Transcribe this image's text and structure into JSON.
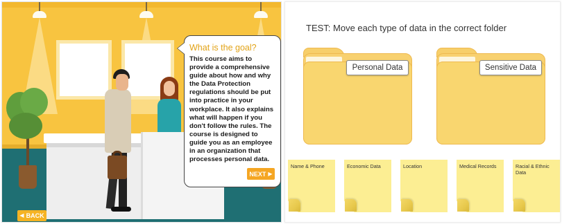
{
  "left_panel": {
    "card": {
      "title": "What is the goal?",
      "body": "This course aims to provide a comprehensive guide about how and why the Data Protection regulations should be put into practice in your workplace. It also explains what will happen if you don't follow the rules. The course is designed to guide you as an employee in an organization that processes personal data.",
      "next_label": "NEXT"
    },
    "back_label": "BACK"
  },
  "right_panel": {
    "title": "TEST: Move each type of data in the correct folder",
    "folders": [
      {
        "label": "Personal Data"
      },
      {
        "label": "Sensitive Data"
      }
    ],
    "notes": [
      {
        "label": "Name & Phone"
      },
      {
        "label": "Economic Data"
      },
      {
        "label": "Location"
      },
      {
        "label": "Medical Records"
      },
      {
        "label": "Racial & Ethnic Data"
      }
    ]
  },
  "colors": {
    "wall": "#f8c440",
    "floor": "#1f6f73",
    "accent_orange": "#f5a623",
    "card_title": "#e2a317",
    "folder": "#f9d66f",
    "sticky_note": "#fcee93"
  }
}
